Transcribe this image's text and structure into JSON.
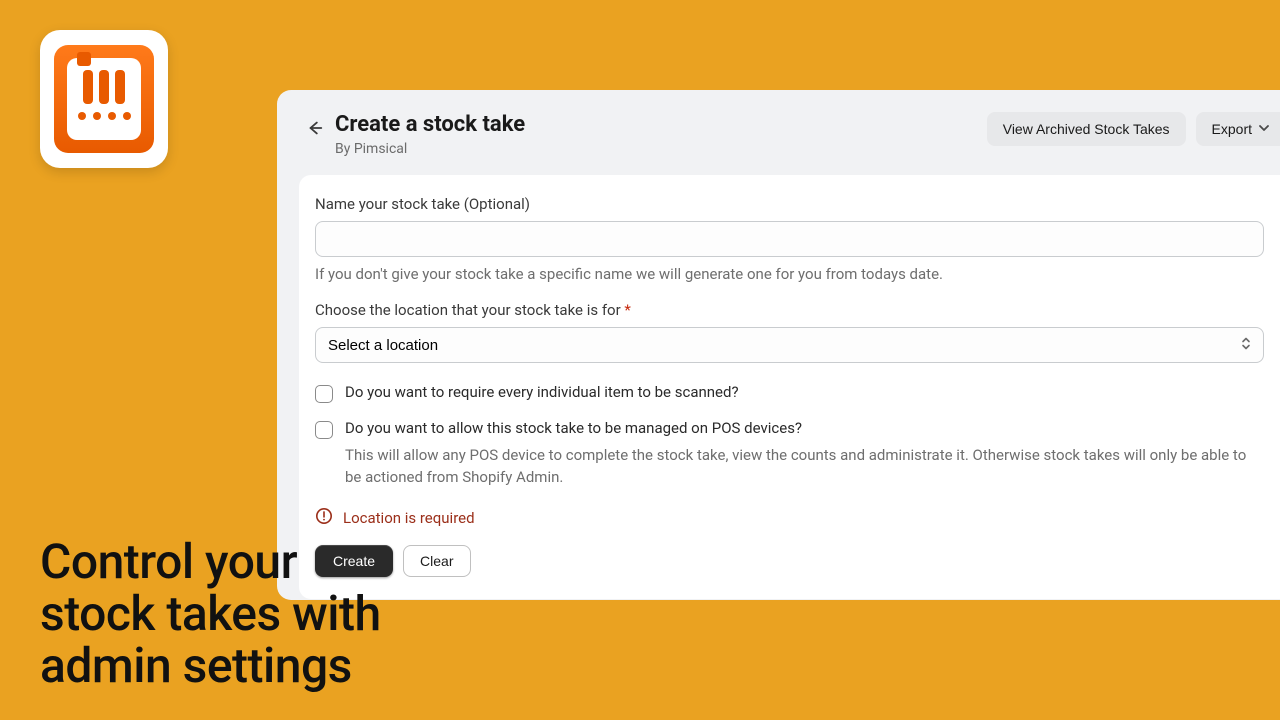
{
  "header": {
    "title": "Create a stock take",
    "byline": "By Pimsical",
    "view_archived_label": "View Archived Stock Takes",
    "export_label": "Export"
  },
  "form": {
    "name_label": "Name your stock take (Optional)",
    "name_value": "",
    "name_help": "If you don't give your stock take a specific name we will generate one for you from todays date.",
    "location_label": "Choose the location that your stock take is for ",
    "location_required_mark": "*",
    "location_placeholder": "Select a location",
    "scan_label": "Do you want to require every individual item to be scanned?",
    "pos_label": "Do you want to allow this stock take to be managed on POS devices?",
    "pos_desc": "This will allow any POS device to complete the stock take, view the counts and administrate it. Otherwise stock takes will only be able to be actioned from Shopify Admin.",
    "error_text": "Location is required",
    "create_label": "Create",
    "clear_label": "Clear"
  },
  "hero": {
    "line1": "Control your",
    "line2": "stock takes with",
    "line3": "admin settings"
  }
}
